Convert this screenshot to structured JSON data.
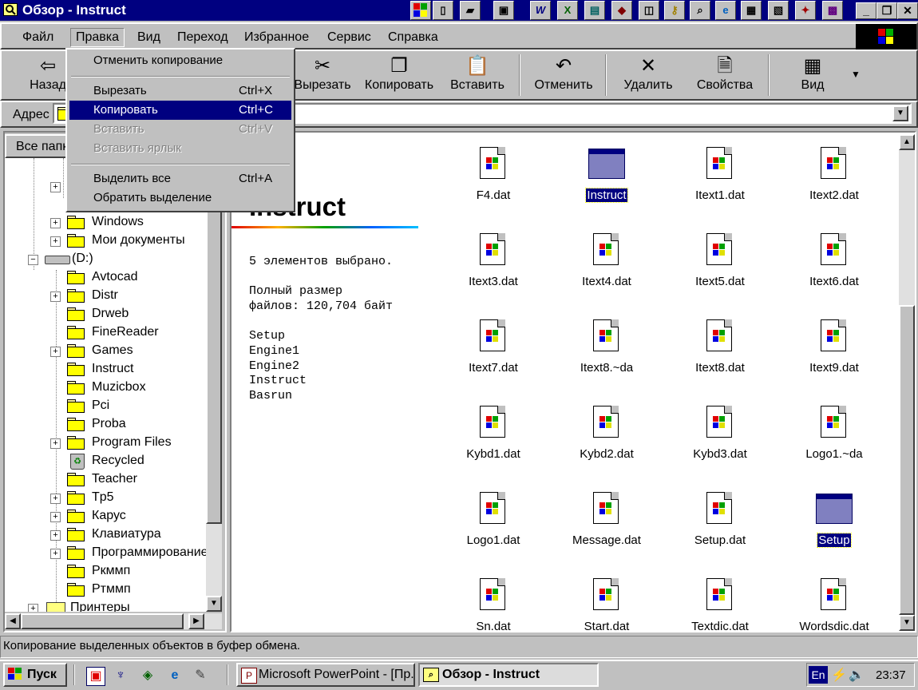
{
  "window": {
    "title": "Обзор - Instruct"
  },
  "menubar": {
    "items": [
      "Файл",
      "Правка",
      "Вид",
      "Переход",
      "Избранное",
      "Сервис",
      "Справка"
    ]
  },
  "edit_menu": {
    "undo": "Отменить копирование",
    "cut": "Вырезать",
    "cut_shortcut": "Ctrl+X",
    "copy": "Копировать",
    "copy_shortcut": "Ctrl+C",
    "paste": "Вставить",
    "paste_shortcut": "Ctrl+V",
    "paste_shortcut_link": "Вставить ярлык",
    "select_all": "Выделить все",
    "select_all_shortcut": "Ctrl+A",
    "invert_selection": "Обратить выделение"
  },
  "toolbar": {
    "back": "Назад",
    "cut": "Вырезать",
    "copy": "Копировать",
    "paste": "Вставить",
    "undo": "Отменить",
    "delete": "Удалить",
    "properties": "Свойства",
    "view": "Вид"
  },
  "address": {
    "label": "Адрес"
  },
  "left_pane": {
    "header": "Все папки",
    "tree": [
      "Windows",
      "Мои документы",
      "(D:)",
      "Avtocad",
      "Distr",
      "Drweb",
      "FineReader",
      "Games",
      "Instruct",
      "Muzicbox",
      "Pci",
      "Proba",
      "Program Files",
      "Recycled",
      "Teacher",
      "Tp5",
      "Карус",
      "Клавиатура",
      "Программирование",
      "Ркммп",
      "Ртммп",
      "Принтеры"
    ]
  },
  "info_panel": {
    "title": "Instruct",
    "selected_count": "5 элементов выбрано.",
    "size_line1": "Полный размер",
    "size_line2": "файлов: 120,704 байт",
    "selected_items": [
      "Setup",
      "Engine1",
      "Engine2",
      "Instruct",
      "Basrun"
    ]
  },
  "files": [
    {
      "name": "F4.dat",
      "type": "doc",
      "selected": false
    },
    {
      "name": "Instruct",
      "type": "exe",
      "selected": true
    },
    {
      "name": "Itext1.dat",
      "type": "doc",
      "selected": false
    },
    {
      "name": "Itext2.dat",
      "type": "doc",
      "selected": false
    },
    {
      "name": "Itext3.dat",
      "type": "doc",
      "selected": false
    },
    {
      "name": "Itext4.dat",
      "type": "doc",
      "selected": false
    },
    {
      "name": "Itext5.dat",
      "type": "doc",
      "selected": false
    },
    {
      "name": "Itext6.dat",
      "type": "doc",
      "selected": false
    },
    {
      "name": "Itext7.dat",
      "type": "doc",
      "selected": false
    },
    {
      "name": "Itext8.~da",
      "type": "doc",
      "selected": false
    },
    {
      "name": "Itext8.dat",
      "type": "doc",
      "selected": false
    },
    {
      "name": "Itext9.dat",
      "type": "doc",
      "selected": false
    },
    {
      "name": "Kybd1.dat",
      "type": "doc",
      "selected": false
    },
    {
      "name": "Kybd2.dat",
      "type": "doc",
      "selected": false
    },
    {
      "name": "Kybd3.dat",
      "type": "doc",
      "selected": false
    },
    {
      "name": "Logo1.~da",
      "type": "doc",
      "selected": false
    },
    {
      "name": "Logo1.dat",
      "type": "doc",
      "selected": false
    },
    {
      "name": "Message.dat",
      "type": "doc",
      "selected": false
    },
    {
      "name": "Setup.dat",
      "type": "doc",
      "selected": false
    },
    {
      "name": "Setup",
      "type": "exe",
      "selected": true
    },
    {
      "name": "Sn.dat",
      "type": "doc",
      "selected": false
    },
    {
      "name": "Start.dat",
      "type": "doc",
      "selected": false
    },
    {
      "name": "Textdic.dat",
      "type": "doc",
      "selected": false
    },
    {
      "name": "Wordsdic.dat",
      "type": "doc",
      "selected": false
    }
  ],
  "statusbar": {
    "text": "Копирование выделенных объектов в буфер обмена."
  },
  "taskbar": {
    "start": "Пуск",
    "tasks": [
      "Microsoft PowerPoint - [Пр...",
      "Обзор - Instruct"
    ],
    "lang": "En",
    "clock": "23:37"
  },
  "colors": {
    "titlebar": "#000080",
    "face": "#c0c0c0",
    "selection": "#000080"
  }
}
